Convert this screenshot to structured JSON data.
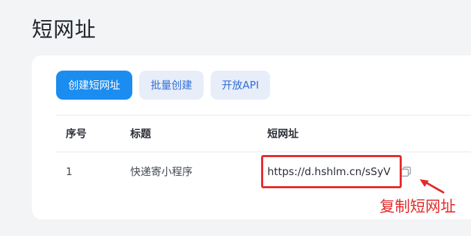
{
  "page": {
    "title": "短网址"
  },
  "toolbar": {
    "create_label": "创建短网址",
    "batch_label": "批量创建",
    "api_label": "开放API"
  },
  "table": {
    "headers": {
      "index": "序号",
      "title": "标题",
      "url": "短网址"
    },
    "rows": [
      {
        "index": "1",
        "title": "快递寄小程序",
        "url": "https://d.hshlm.cn/sSyV"
      }
    ]
  },
  "annotation": {
    "label": "复制短网址",
    "color": "#e52a2a"
  },
  "icons": {
    "copy": "copy-icon"
  },
  "colors": {
    "primary": "#1b8cf0",
    "secondary_bg": "#e8edfa",
    "secondary_text": "#2f6fd6",
    "highlight": "#e52a2a"
  }
}
